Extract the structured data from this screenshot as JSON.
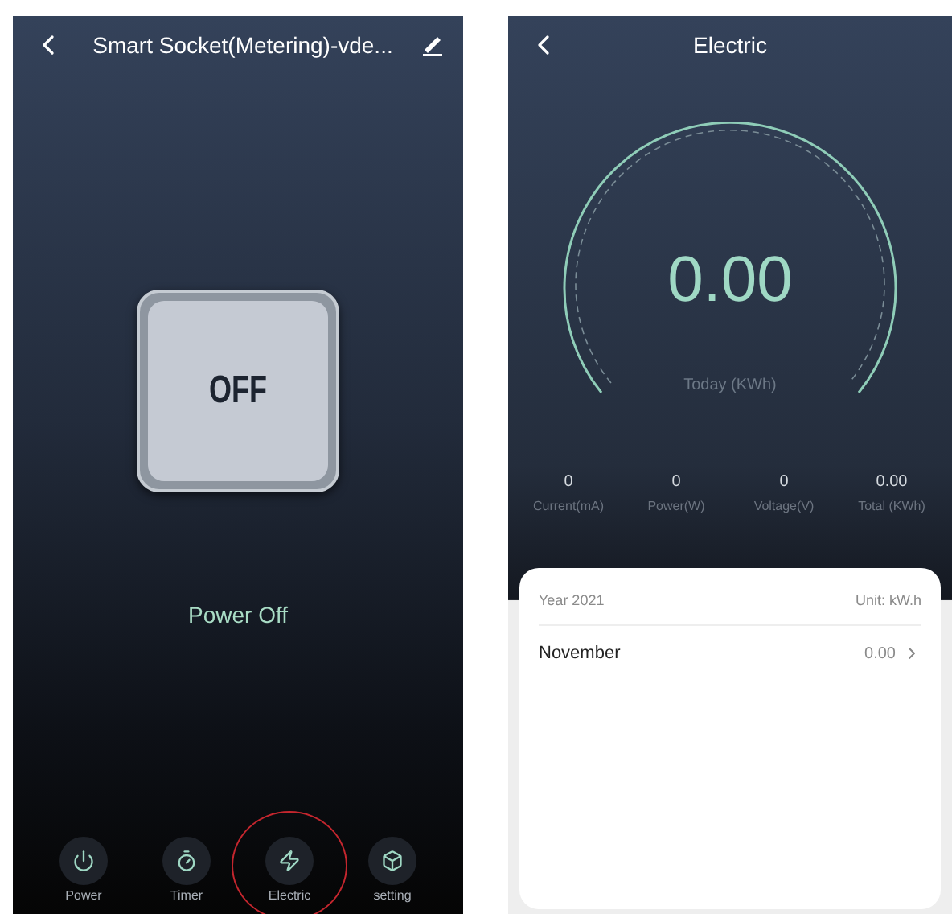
{
  "device_screen": {
    "title": "Smart Socket(Metering)-vde...",
    "switch_label": "OFF",
    "switch_on": false,
    "status": "Power Off",
    "nav": [
      {
        "label": "Power",
        "selected": false
      },
      {
        "label": "Timer",
        "selected": false
      },
      {
        "label": "Electric",
        "selected": true
      },
      {
        "label": "setting",
        "selected": false
      }
    ]
  },
  "electric_screen": {
    "title": "Electric",
    "today_value": "0.00",
    "today_label": "Today (KWh)",
    "stats": [
      {
        "value": "0",
        "label": "Current(mA)"
      },
      {
        "value": "0",
        "label": "Power(W)"
      },
      {
        "value": "0",
        "label": "Voltage(V)"
      },
      {
        "value": "0.00",
        "label": "Total (KWh)"
      }
    ],
    "history": {
      "year": "Year 2021",
      "unit": "Unit: kW.h",
      "rows": [
        {
          "month": "November",
          "value": "0.00"
        }
      ]
    }
  }
}
